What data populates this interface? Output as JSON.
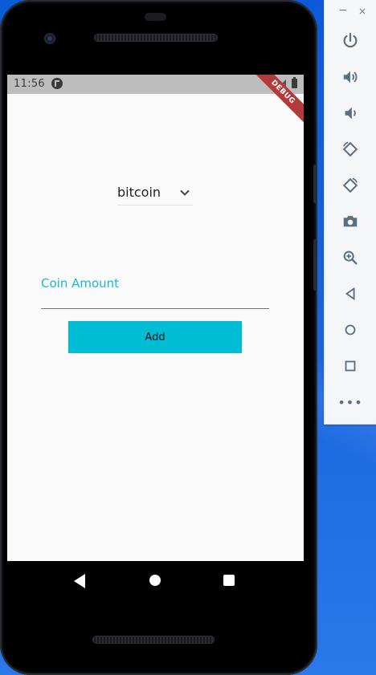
{
  "status_bar": {
    "time": "11:56"
  },
  "debug_banner": "DEBUG",
  "dropdown": {
    "selected": "bitcoin"
  },
  "coin_field": {
    "label": "Coin Amount",
    "value": ""
  },
  "add_button": {
    "label": "Add"
  },
  "toolbar": {
    "minimize": "−",
    "close": "×",
    "buttons": [
      "power-icon",
      "volume-up-icon",
      "volume-down-icon",
      "rotate-left-icon",
      "rotate-right-icon",
      "camera-icon",
      "zoom-icon",
      "back-icon",
      "home-icon",
      "overview-icon",
      "more-icon"
    ],
    "more_label": "•••"
  },
  "colors": {
    "accent": "#00bcd4",
    "label_accent": "#19b8d2",
    "status_bar": "#bdbdbd",
    "debug_banner": "#b23a3a",
    "toolbar_icon": "#5b6f80"
  }
}
